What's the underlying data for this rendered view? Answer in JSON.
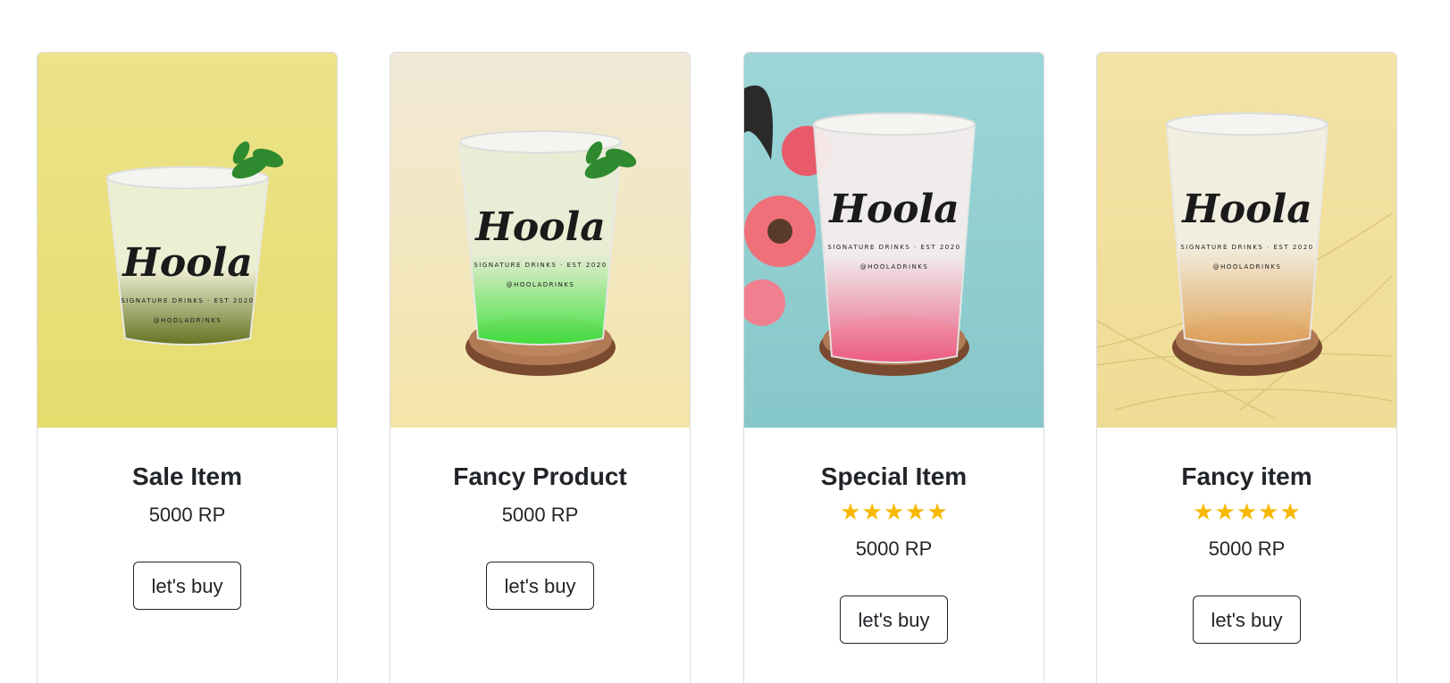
{
  "products": [
    {
      "title": "Sale Item",
      "price": "5000 RP",
      "button": "let's buy",
      "rating": null,
      "bg_top": "#ece38a",
      "bg_bottom": "#e6dc6e",
      "drink_top": "#eef0d8",
      "drink_bottom": "#5f6e1e",
      "mint": true,
      "coaster": false
    },
    {
      "title": "Fancy Product",
      "price": "5000 RP",
      "button": "let's buy",
      "rating": null,
      "bg_top": "#f1e9d8",
      "bg_bottom": "#f4e5a8",
      "drink_top": "#e8eed6",
      "drink_bottom": "#3ae03a",
      "mint": true,
      "coaster": true
    },
    {
      "title": "Special Item",
      "price": "5000 RP",
      "button": "let's buy",
      "rating": 5,
      "bg_top": "#9ed6d8",
      "bg_bottom": "#86c7c9",
      "drink_top": "#f6eeee",
      "drink_bottom": "#f05a82",
      "mint": false,
      "coaster": true
    },
    {
      "title": "Fancy item",
      "price": "5000 RP",
      "button": "let's buy",
      "rating": 5,
      "bg_top": "#f3e3a6",
      "bg_bottom": "#efdc95",
      "drink_top": "#f2efe4",
      "drink_bottom": "#e0a056",
      "mint": false,
      "coaster": true
    }
  ],
  "cup_brand": "Hoola",
  "cup_tagline": "SIGNATURE DRINKS · EST 2020",
  "cup_handle": "@HOOLADRINKS",
  "star_color": "#f7b800"
}
